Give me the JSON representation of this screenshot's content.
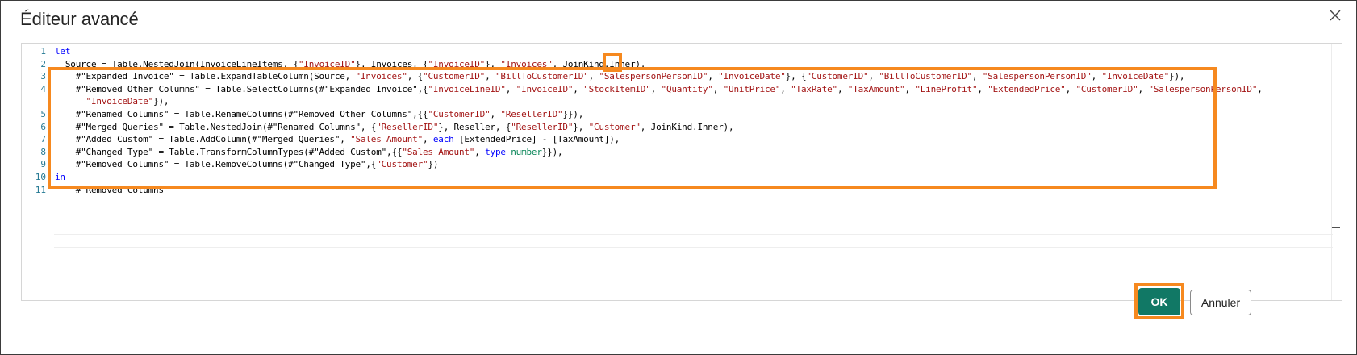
{
  "dialog": {
    "title": "Éditeur avancé",
    "ok_label": "OK",
    "cancel_label": "Annuler"
  },
  "editor": {
    "line_numbers": [
      "1",
      "2",
      "3",
      "4",
      "",
      "5",
      "6",
      "7",
      "8",
      "9",
      "10",
      "11"
    ],
    "lines": [
      [
        {
          "t": "let",
          "c": "kw"
        }
      ],
      [
        {
          "t": "  Source = Table.NestedJoin(InvoiceLineItems, {"
        },
        {
          "t": "\"InvoiceID\"",
          "c": "str"
        },
        {
          "t": "}, Invoices, {"
        },
        {
          "t": "\"InvoiceID\"",
          "c": "str"
        },
        {
          "t": "}, "
        },
        {
          "t": "\"Invoices\"",
          "c": "str"
        },
        {
          "t": ", JoinKind.Inner),"
        }
      ],
      [
        {
          "t": "    #\"Expanded Invoice\" = Table.ExpandTableColumn(Source, "
        },
        {
          "t": "\"Invoices\"",
          "c": "str"
        },
        {
          "t": ", {"
        },
        {
          "t": "\"CustomerID\"",
          "c": "str"
        },
        {
          "t": ", "
        },
        {
          "t": "\"BillToCustomerID\"",
          "c": "str"
        },
        {
          "t": ", "
        },
        {
          "t": "\"SalespersonPersonID\"",
          "c": "str"
        },
        {
          "t": ", "
        },
        {
          "t": "\"InvoiceDate\"",
          "c": "str"
        },
        {
          "t": "}, {"
        },
        {
          "t": "\"CustomerID\"",
          "c": "str"
        },
        {
          "t": ", "
        },
        {
          "t": "\"BillToCustomerID\"",
          "c": "str"
        },
        {
          "t": ", "
        },
        {
          "t": "\"SalespersonPersonID\"",
          "c": "str"
        },
        {
          "t": ", "
        },
        {
          "t": "\"InvoiceDate\"",
          "c": "str"
        },
        {
          "t": "}),"
        }
      ],
      [
        {
          "t": "    #\"Removed Other Columns\" = Table.SelectColumns(#\"Expanded Invoice\",{"
        },
        {
          "t": "\"InvoiceLineID\"",
          "c": "str"
        },
        {
          "t": ", "
        },
        {
          "t": "\"InvoiceID\"",
          "c": "str"
        },
        {
          "t": ", "
        },
        {
          "t": "\"StockItemID\"",
          "c": "str"
        },
        {
          "t": ", "
        },
        {
          "t": "\"Quantity\"",
          "c": "str"
        },
        {
          "t": ", "
        },
        {
          "t": "\"UnitPrice\"",
          "c": "str"
        },
        {
          "t": ", "
        },
        {
          "t": "\"TaxRate\"",
          "c": "str"
        },
        {
          "t": ", "
        },
        {
          "t": "\"TaxAmount\"",
          "c": "str"
        },
        {
          "t": ", "
        },
        {
          "t": "\"LineProfit\"",
          "c": "str"
        },
        {
          "t": ", "
        },
        {
          "t": "\"ExtendedPrice\"",
          "c": "str"
        },
        {
          "t": ", "
        },
        {
          "t": "\"CustomerID\"",
          "c": "str"
        },
        {
          "t": ", "
        },
        {
          "t": "\"SalespersonPersonID\"",
          "c": "str"
        },
        {
          "t": ","
        }
      ],
      [
        {
          "t": "      "
        },
        {
          "t": "\"InvoiceDate\"",
          "c": "str"
        },
        {
          "t": "}),"
        }
      ],
      [
        {
          "t": "    #\"Renamed Columns\" = Table.RenameColumns(#\"Removed Other Columns\",{{"
        },
        {
          "t": "\"CustomerID\"",
          "c": "str"
        },
        {
          "t": ", "
        },
        {
          "t": "\"ResellerID\"",
          "c": "str"
        },
        {
          "t": "}}),"
        }
      ],
      [
        {
          "t": "    #\"Merged Queries\" = Table.NestedJoin(#\"Renamed Columns\", {"
        },
        {
          "t": "\"ResellerID\"",
          "c": "str"
        },
        {
          "t": "}, Reseller, {"
        },
        {
          "t": "\"ResellerID\"",
          "c": "str"
        },
        {
          "t": "}, "
        },
        {
          "t": "\"Customer\"",
          "c": "str"
        },
        {
          "t": ", JoinKind.Inner),"
        }
      ],
      [
        {
          "t": "    #\"Added Custom\" = Table.AddColumn(#\"Merged Queries\", "
        },
        {
          "t": "\"Sales Amount\"",
          "c": "str"
        },
        {
          "t": ", "
        },
        {
          "t": "each",
          "c": "kw"
        },
        {
          "t": " [ExtendedPrice] - [TaxAmount]),"
        }
      ],
      [
        {
          "t": "    #\"Changed Type\" = Table.TransformColumnTypes(#\"Added Custom\",{{"
        },
        {
          "t": "\"Sales Amount\"",
          "c": "str"
        },
        {
          "t": ", "
        },
        {
          "t": "type",
          "c": "kw"
        },
        {
          "t": " "
        },
        {
          "t": "number",
          "c": "type"
        },
        {
          "t": "}}),"
        }
      ],
      [
        {
          "t": "    #\"Removed Columns\" = Table.RemoveColumns(#\"Changed Type\",{"
        },
        {
          "t": "\"Customer\"",
          "c": "str"
        },
        {
          "t": "})"
        }
      ],
      [
        {
          "t": "in",
          "c": "kw"
        }
      ],
      [
        {
          "t": "    #\"Removed Columns\""
        }
      ]
    ]
  },
  "colors": {
    "accent_highlight": "#f6891f",
    "ok_button": "#117865",
    "keyword": "#0000ff",
    "string": "#a31515",
    "line_number": "#237893"
  },
  "icons": {
    "close": "close-icon"
  }
}
